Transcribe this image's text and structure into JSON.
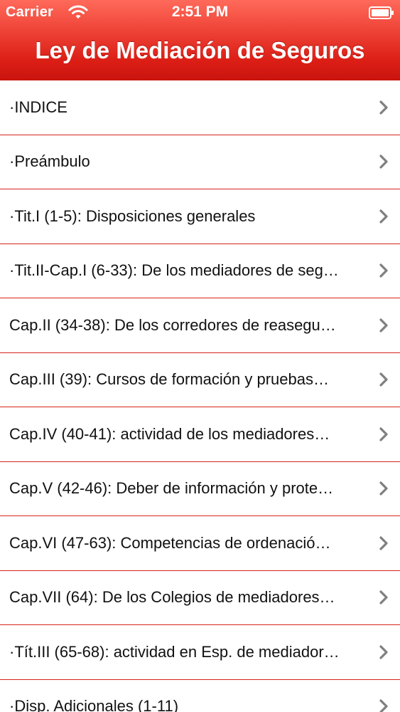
{
  "status_bar": {
    "carrier": "Carrier",
    "time": "2:51 PM",
    "wifi_icon": "wifi-icon",
    "battery_icon": "battery-icon"
  },
  "nav": {
    "title": "Ley de Mediación de Seguros",
    "background_color": "#dc1f16",
    "title_color": "#ffffff"
  },
  "list": {
    "separator_color": "#d7231b",
    "chevron_color": "#7f7f7f",
    "items": [
      {
        "label": "·INDICE"
      },
      {
        "label": "·Preámbulo"
      },
      {
        "label": "·Tit.I (1-5): Disposiciones generales"
      },
      {
        "label": "·Tit.II-Cap.I (6-33): De los mediadores de seg…"
      },
      {
        "label": "Cap.II (34-38): De los corredores de reasegu…"
      },
      {
        "label": "Cap.III (39): Cursos de formación y pruebas…"
      },
      {
        "label": "Cap.IV (40-41): actividad de los mediadores…"
      },
      {
        "label": "Cap.V (42-46): Deber de información y prote…"
      },
      {
        "label": "Cap.VI (47-63): Competencias de ordenació…"
      },
      {
        "label": "Cap.VII (64): De los Colegios de mediadores…"
      },
      {
        "label": "·Tít.III (65-68): actividad en Esp. de mediador…"
      },
      {
        "label": "·Disp. Adicionales (1-11)"
      }
    ]
  }
}
